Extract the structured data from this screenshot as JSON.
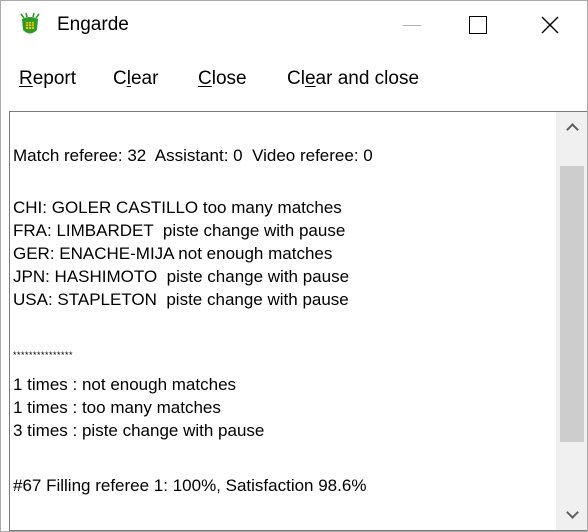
{
  "window": {
    "title": "Engarde"
  },
  "icons": {
    "app": "fencer-mask-icon",
    "minimize": "minimize-icon",
    "maximize": "maximize-icon",
    "close": "close-icon",
    "scroll_up": "chevron-up-icon",
    "scroll_down": "chevron-down-icon"
  },
  "colors": {
    "app_icon_body": "#2f9a2a",
    "app_icon_accent": "#f2c400",
    "scroll_thumb": "#cdcdcd",
    "scroll_track": "#f0f0f0"
  },
  "menu": {
    "report": {
      "mnemonic": "R",
      "rest": "eport"
    },
    "clear": {
      "pre": "C",
      "mnemonic": "l",
      "rest": "ear"
    },
    "close": {
      "mnemonic": "C",
      "rest": "lose"
    },
    "clear_and_close": {
      "pre": "Cl",
      "mnemonic": "e",
      "rest": "ar and close"
    }
  },
  "content": {
    "referees": "Match referee: 32  Assistant: 0  Video referee: 0",
    "issues": [
      "CHI: GOLER CASTILLO too many matches",
      "FRA: LIMBARDET  piste change with pause",
      "GER: ENACHE-MIJA not enough matches",
      "JPN: HASHIMOTO  piste change with pause",
      "USA: STAPLETON  piste change with pause"
    ],
    "separator": "***************",
    "summary": [
      "1 times : not enough matches",
      "1 times : too many matches",
      "3 times : piste change with pause"
    ],
    "footer": "#67 Filling referee 1: 100%, Satisfaction 98.6%"
  }
}
